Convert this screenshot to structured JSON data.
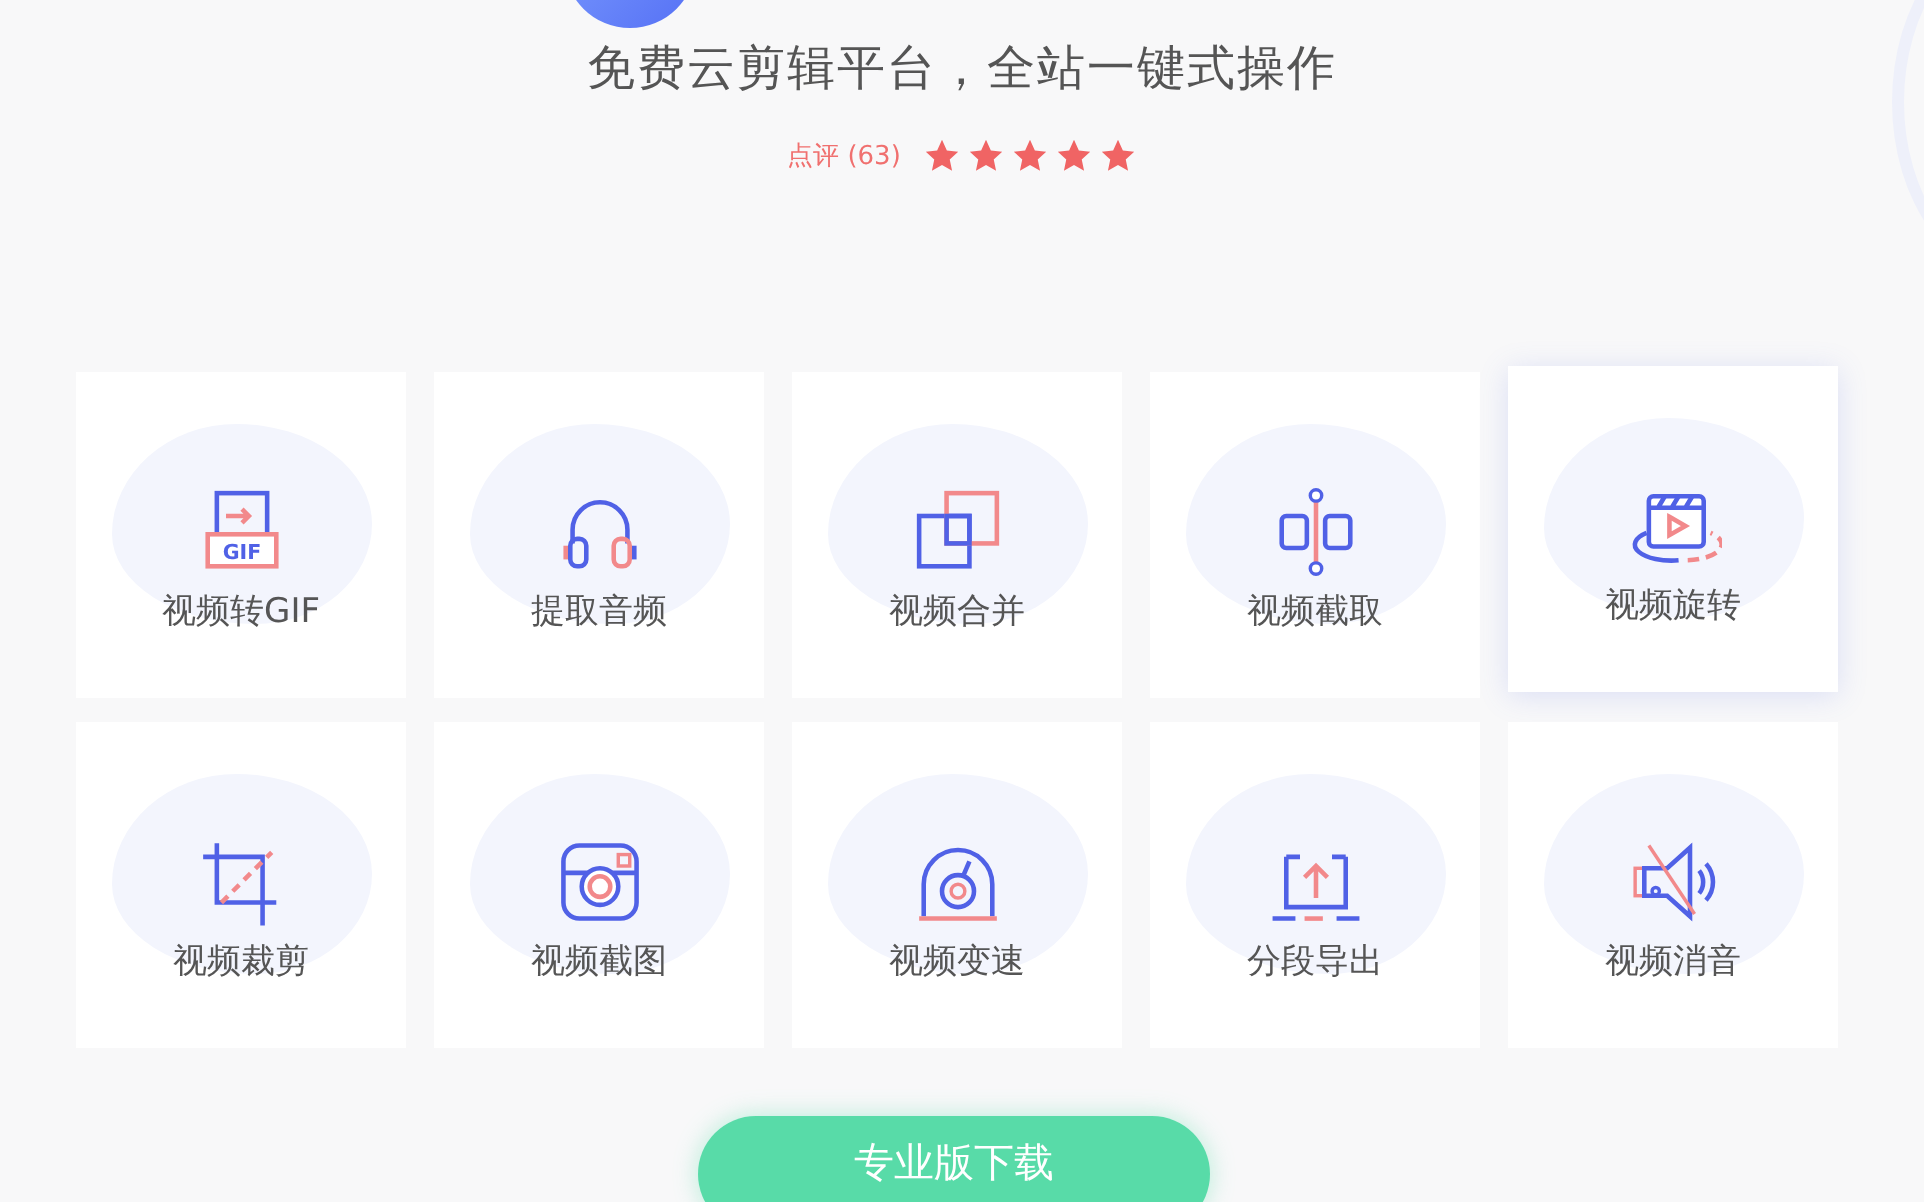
{
  "header": {
    "subtitle": "免费云剪辑平台，全站一键式操作",
    "rating": {
      "label": "点评 (63)",
      "stars": 5
    }
  },
  "tools": [
    {
      "label": "视频转GIF",
      "kind": "gif",
      "badge": "GIF",
      "highlighted": false
    },
    {
      "label": "提取音频",
      "kind": "headphones",
      "highlighted": false
    },
    {
      "label": "视频合并",
      "kind": "merge",
      "highlighted": false
    },
    {
      "label": "视频截取",
      "kind": "split",
      "highlighted": false
    },
    {
      "label": "视频旋转",
      "kind": "rotate",
      "highlighted": true
    },
    {
      "label": "视频裁剪",
      "kind": "crop",
      "highlighted": false
    },
    {
      "label": "视频截图",
      "kind": "camera",
      "highlighted": false
    },
    {
      "label": "视频变速",
      "kind": "speed",
      "highlighted": false
    },
    {
      "label": "分段导出",
      "kind": "export",
      "highlighted": false
    },
    {
      "label": "视频消音",
      "kind": "mute",
      "highlighted": false
    }
  ],
  "download_button": "专业版下载"
}
